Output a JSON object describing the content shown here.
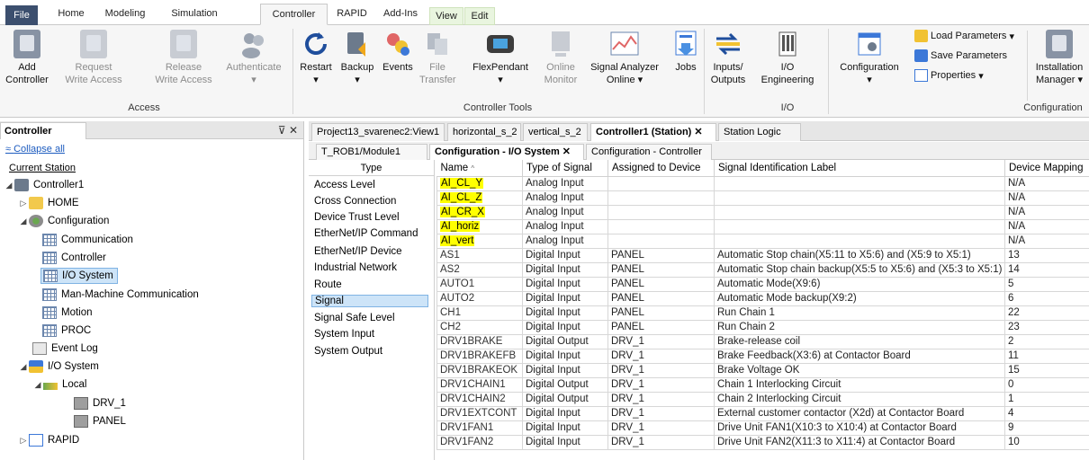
{
  "menu": {
    "tabs": [
      "File",
      "Home",
      "Modeling",
      "Simulation",
      "Controller",
      "RAPID",
      "Add-Ins",
      "View",
      "Edit"
    ],
    "active": "Controller"
  },
  "ribbon": {
    "access": {
      "group_label": "Access",
      "add_controller": [
        "Add",
        "Controller"
      ],
      "request_write": [
        "Request",
        "Write Access"
      ],
      "release_write": [
        "Release",
        "Write Access"
      ],
      "authenticate": "Authenticate"
    },
    "controller_tools": {
      "group_label": "Controller Tools",
      "restart": "Restart",
      "backup": "Backup",
      "events": "Events",
      "file_transfer": [
        "File",
        "Transfer"
      ],
      "flexpendant": "FlexPendant",
      "online_monitor": [
        "Online",
        "Monitor"
      ],
      "signal_analyzer": [
        "Signal Analyzer",
        "Online"
      ],
      "jobs": "Jobs"
    },
    "io": {
      "group_label": "I/O",
      "inputs_outputs": [
        "Inputs/",
        "Outputs"
      ],
      "io_engineering": [
        "I/O",
        "Engineering"
      ]
    },
    "configuration": {
      "group_label": "Configuration",
      "configuration": "Configuration",
      "load_parameters": "Load Parameters",
      "save_parameters": "Save Parameters",
      "properties": "Properties",
      "installation_manager": [
        "Installation",
        "Manager"
      ]
    }
  },
  "left_panel": {
    "title": "Controller",
    "collapse_all": "Collapse all",
    "current_station": "Current Station",
    "tree": {
      "controller1": "Controller1",
      "home": "HOME",
      "configuration": "Configuration",
      "communication": "Communication",
      "controller": "Controller",
      "io_system": "I/O System",
      "mmc": "Man-Machine Communication",
      "motion": "Motion",
      "proc": "PROC",
      "event_log": "Event Log",
      "io_system2": "I/O System",
      "local": "Local",
      "drv1": "DRV_1",
      "panel": "PANEL",
      "rapid": "RAPID"
    }
  },
  "doc_tabs": [
    "Project13_svarenec2:View1",
    "horizontal_s_2",
    "vertical_s_2",
    "Controller1 (Station)",
    "Station Logic"
  ],
  "sub_tabs": [
    "T_ROB1/Module1",
    "Configuration - I/O System",
    "Configuration - Controller"
  ],
  "types": {
    "header": "Type",
    "items": [
      "Access Level",
      "Cross Connection",
      "Device Trust Level",
      "EtherNet/IP Command",
      "EtherNet/IP Device",
      "Industrial Network",
      "Route",
      "Signal",
      "Signal Safe Level",
      "System Input",
      "System Output"
    ],
    "selected": "Signal"
  },
  "table": {
    "columns": [
      "Name",
      "Type of Signal",
      "Assigned to Device",
      "Signal Identification Label",
      "Device Mapping"
    ],
    "rows": [
      {
        "name": "AI_CL_Y",
        "type": "Analog Input",
        "device": "",
        "label": "",
        "mapping": "N/A",
        "hl": true
      },
      {
        "name": "AI_CL_Z",
        "type": "Analog Input",
        "device": "",
        "label": "",
        "mapping": "N/A",
        "hl": true
      },
      {
        "name": "AI_CR_X",
        "type": "Analog Input",
        "device": "",
        "label": "",
        "mapping": "N/A",
        "hl": true
      },
      {
        "name": "AI_horiz",
        "type": "Analog Input",
        "device": "",
        "label": "",
        "mapping": "N/A",
        "hl": true
      },
      {
        "name": "AI_vert",
        "type": "Analog Input",
        "device": "",
        "label": "",
        "mapping": "N/A",
        "hl": true
      },
      {
        "name": "AS1",
        "type": "Digital Input",
        "device": "PANEL",
        "label": "Automatic Stop chain(X5:11 to X5:6) and (X5:9 to X5:1)",
        "mapping": "13"
      },
      {
        "name": "AS2",
        "type": "Digital Input",
        "device": "PANEL",
        "label": "Automatic Stop chain backup(X5:5 to X5:6) and (X5:3 to X5:1)",
        "mapping": "14"
      },
      {
        "name": "AUTO1",
        "type": "Digital Input",
        "device": "PANEL",
        "label": "Automatic Mode(X9:6)",
        "mapping": "5"
      },
      {
        "name": "AUTO2",
        "type": "Digital Input",
        "device": "PANEL",
        "label": "Automatic Mode backup(X9:2)",
        "mapping": "6"
      },
      {
        "name": "CH1",
        "type": "Digital Input",
        "device": "PANEL",
        "label": "Run Chain 1",
        "mapping": "22"
      },
      {
        "name": "CH2",
        "type": "Digital Input",
        "device": "PANEL",
        "label": "Run Chain 2",
        "mapping": "23"
      },
      {
        "name": "DRV1BRAKE",
        "type": "Digital Output",
        "device": "DRV_1",
        "label": "Brake-release coil",
        "mapping": "2"
      },
      {
        "name": "DRV1BRAKEFB",
        "type": "Digital Input",
        "device": "DRV_1",
        "label": "Brake Feedback(X3:6) at Contactor Board",
        "mapping": "11"
      },
      {
        "name": "DRV1BRAKEOK",
        "type": "Digital Input",
        "device": "DRV_1",
        "label": "Brake Voltage OK",
        "mapping": "15"
      },
      {
        "name": "DRV1CHAIN1",
        "type": "Digital Output",
        "device": "DRV_1",
        "label": "Chain 1 Interlocking Circuit",
        "mapping": "0"
      },
      {
        "name": "DRV1CHAIN2",
        "type": "Digital Output",
        "device": "DRV_1",
        "label": "Chain 2 Interlocking Circuit",
        "mapping": "1"
      },
      {
        "name": "DRV1EXTCONT",
        "type": "Digital Input",
        "device": "DRV_1",
        "label": "External customer contactor (X2d) at Contactor Board",
        "mapping": "4"
      },
      {
        "name": "DRV1FAN1",
        "type": "Digital Input",
        "device": "DRV_1",
        "label": "Drive Unit FAN1(X10:3 to X10:4) at Contactor Board",
        "mapping": "9"
      },
      {
        "name": "DRV1FAN2",
        "type": "Digital Input",
        "device": "DRV_1",
        "label": "Drive Unit FAN2(X11:3 to X11:4) at Contactor Board",
        "mapping": "10"
      }
    ]
  },
  "colors": {
    "highlight": "#ffff00",
    "file_tab": "#3c4f6e",
    "selection": "#cde4f8"
  }
}
